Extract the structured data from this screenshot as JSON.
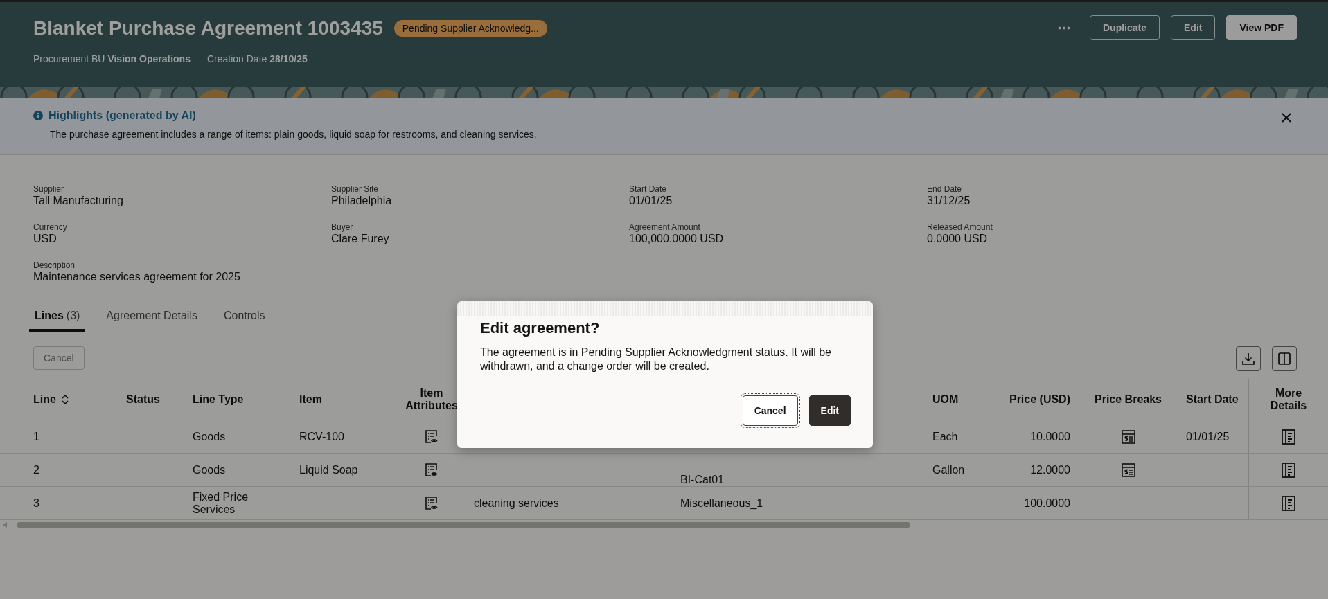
{
  "header": {
    "title": "Blanket Purchase Agreement 1003435",
    "status_badge": "Pending Supplier Acknowledg...",
    "meta": [
      {
        "label": "Procurement BU",
        "value": "Vision Operations"
      },
      {
        "label": "Creation Date",
        "value": "28/10/25"
      }
    ],
    "buttons": [
      {
        "label": "Duplicate",
        "kind": "outline"
      },
      {
        "label": "Edit",
        "kind": "outline"
      },
      {
        "label": "View PDF",
        "kind": "filled"
      }
    ]
  },
  "highlights": {
    "title": "Highlights (generated by AI)",
    "text": "The purchase agreement includes a range of items: plain goods, liquid soap for restrooms, and cleaning services."
  },
  "details": [
    {
      "label": "Supplier",
      "value": "Tall Manufacturing"
    },
    {
      "label": "Supplier Site",
      "value": "Philadelphia"
    },
    {
      "label": "Start Date",
      "value": "01/01/25"
    },
    {
      "label": "End Date",
      "value": "31/12/25"
    },
    {
      "label": "Currency",
      "value": "USD"
    },
    {
      "label": "Buyer",
      "value": "Clare Furey"
    },
    {
      "label": "Agreement Amount",
      "value": "100,000.0000 USD"
    },
    {
      "label": "Released Amount",
      "value": "0.0000 USD"
    },
    {
      "label": "Description",
      "value": "Maintenance services agreement for 2025"
    }
  ],
  "tabs": [
    {
      "label": "Lines",
      "count": "(3)",
      "selected": true
    },
    {
      "label": "Agreement Details",
      "selected": false
    },
    {
      "label": "Controls",
      "selected": false
    }
  ],
  "toolbar": {
    "cancel": {
      "label": "Cancel",
      "disabled": true
    }
  },
  "table": {
    "columns": {
      "line": "Line",
      "status": "Status",
      "line_type": "Line Type",
      "item": "Item",
      "attributes": "Item Attributes",
      "uom": "UOM",
      "price": "Price (USD)",
      "price_breaks": "Price Breaks",
      "start_date": "Start Date",
      "more_details": "More Details"
    },
    "rows": [
      {
        "line": "1",
        "line_type": "Goods",
        "item": "RCV-100",
        "uom": "Each",
        "price": "10.0000",
        "price_breaks": true,
        "start_date": "01/01/25"
      },
      {
        "line": "2",
        "line_type": "Goods",
        "item": "Liquid Soap",
        "category": "BI-Cat01",
        "uom": "Gallon",
        "price": "12.0000",
        "price_breaks": true
      },
      {
        "line": "3",
        "line_type": "Fixed Price Services",
        "description": "cleaning services",
        "category": "Miscellaneous_1",
        "price": "100.0000",
        "price_breaks": false
      }
    ]
  },
  "dialog": {
    "title": "Edit agreement?",
    "text": "The agreement is in Pending Supplier Acknowledgment status. It will be withdrawn, and a change order will be created.",
    "buttons": [
      {
        "label": "Cancel",
        "kind": "secondary"
      },
      {
        "label": "Edit",
        "kind": "primary"
      }
    ]
  }
}
